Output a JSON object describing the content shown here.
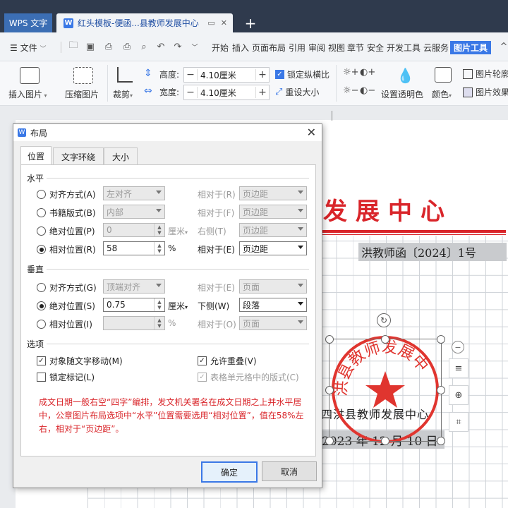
{
  "titlebar": {
    "app_tab": "WPS 文字",
    "doc_tab": "红头模板-便函...县教师发展中心"
  },
  "menubar": {
    "file": "文件",
    "items": [
      "开始",
      "插入",
      "页面布局",
      "引用",
      "审阅",
      "视图",
      "章节",
      "安全",
      "开发工具",
      "云服务"
    ],
    "active": "图片工具"
  },
  "ribbon": {
    "insert_picture": "插入图片",
    "compress_picture": "压缩图片",
    "crop": "裁剪",
    "height_label": "高度:",
    "height_value": "4.10厘米",
    "width_label": "宽度:",
    "width_value": "4.10厘米",
    "lock_ratio": "锁定纵横比",
    "reset_size": "重设大小",
    "set_transparent": "设置透明色",
    "color": "颜色",
    "picture_outline": "图片轮廓",
    "picture_effects": "图片效果"
  },
  "document": {
    "red_header": "发展中心",
    "doc_number": "洪教师函〔2024〕1号",
    "issuer": "四洪县教师发展中心",
    "date": "2023 年 12 月 10 日",
    "seal_text": "洪县教师发展中"
  },
  "dialog": {
    "title": "布局",
    "tabs": [
      "位置",
      "文字环绕",
      "大小"
    ],
    "horizontal": {
      "section": "水平",
      "rows": [
        {
          "label": "对齐方式(A)",
          "value": "左对齐",
          "rel_label": "相对于(R)",
          "rel_value": "页边距"
        },
        {
          "label": "书籍版式(B)",
          "value": "内部",
          "rel_label": "相对于(F)",
          "rel_value": "页边距"
        },
        {
          "label": "绝对位置(P)",
          "value": "0",
          "unit": "厘米",
          "rel_label": "右侧(T)",
          "rel_value": "页边距"
        },
        {
          "label": "相对位置(R)",
          "value": "58",
          "unit": "%",
          "rel_label": "相对于(E)",
          "rel_value": "页边距"
        }
      ],
      "selected": 3
    },
    "vertical": {
      "section": "垂直",
      "rows": [
        {
          "label": "对齐方式(G)",
          "value": "顶端对齐",
          "rel_label": "相对于(E)",
          "rel_value": "页面"
        },
        {
          "label": "绝对位置(S)",
          "value": "0.75",
          "unit": "厘米",
          "rel_label": "下侧(W)",
          "rel_value": "段落"
        },
        {
          "label": "相对位置(I)",
          "value": "",
          "unit": "%",
          "rel_label": "相对于(O)",
          "rel_value": "页面"
        }
      ],
      "selected": 1
    },
    "options": {
      "section": "选项",
      "move_with_text": "对象随文字移动(M)",
      "move_with_text_checked": true,
      "allow_overlap": "允许重叠(V)",
      "allow_overlap_checked": true,
      "lock_anchor": "锁定标记(L)",
      "lock_anchor_checked": false,
      "table_layout": "表格单元格中的版式(C)",
      "table_layout_checked": true
    },
    "note": "成文日期一般右空“四字”编排，发文机关署名在成文日期之上并水平居中，公章图片布局选项中“水平”位置需要选用“相对位置”，值在58%左右，相对于“页边距”。",
    "ok": "确定",
    "cancel": "取消"
  }
}
